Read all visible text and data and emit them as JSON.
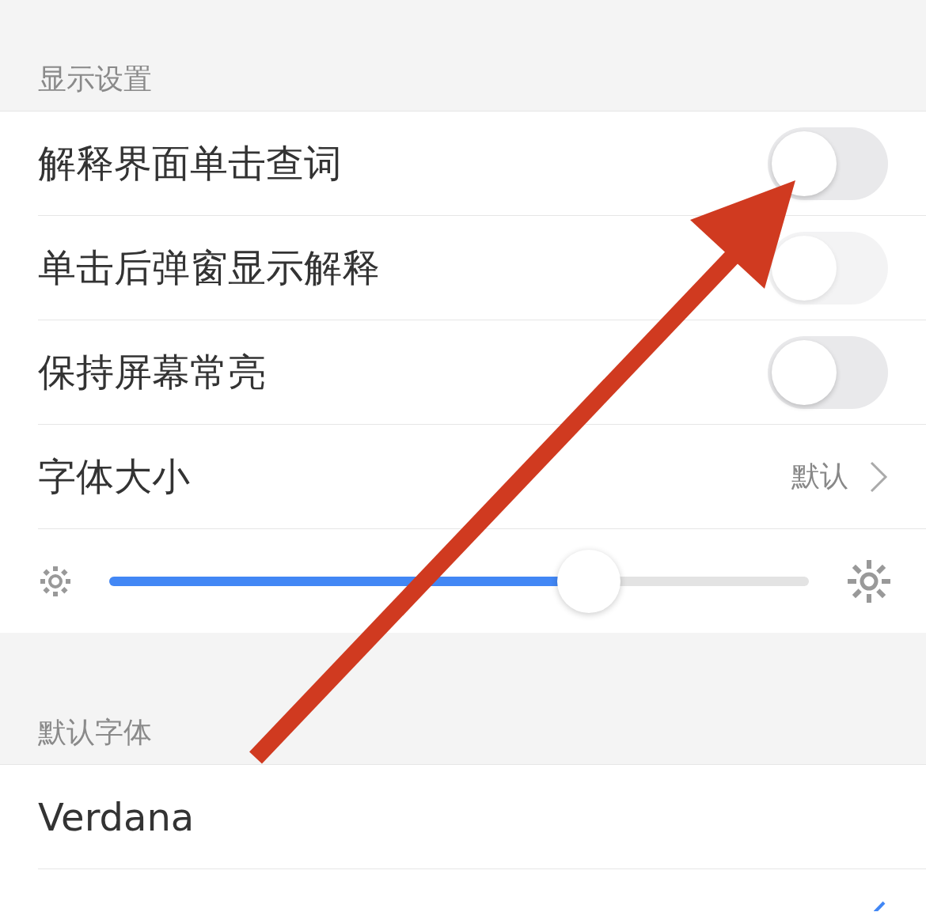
{
  "display_section": {
    "title": "显示设置",
    "rows": [
      {
        "kind": "toggle",
        "label": "解释界面单击查词",
        "on": false,
        "disabled": false
      },
      {
        "kind": "toggle",
        "label": "单击后弹窗显示解释",
        "on": false,
        "disabled": true
      },
      {
        "kind": "toggle",
        "label": "保持屏幕常亮",
        "on": false,
        "disabled": false
      },
      {
        "kind": "value",
        "label": "字体大小",
        "value": "默认"
      },
      {
        "kind": "slider",
        "level": 0.685
      }
    ]
  },
  "font_section": {
    "title": "默认字体",
    "fonts": [
      {
        "name": "Verdana",
        "selected": false
      },
      {
        "selected": true
      }
    ]
  }
}
